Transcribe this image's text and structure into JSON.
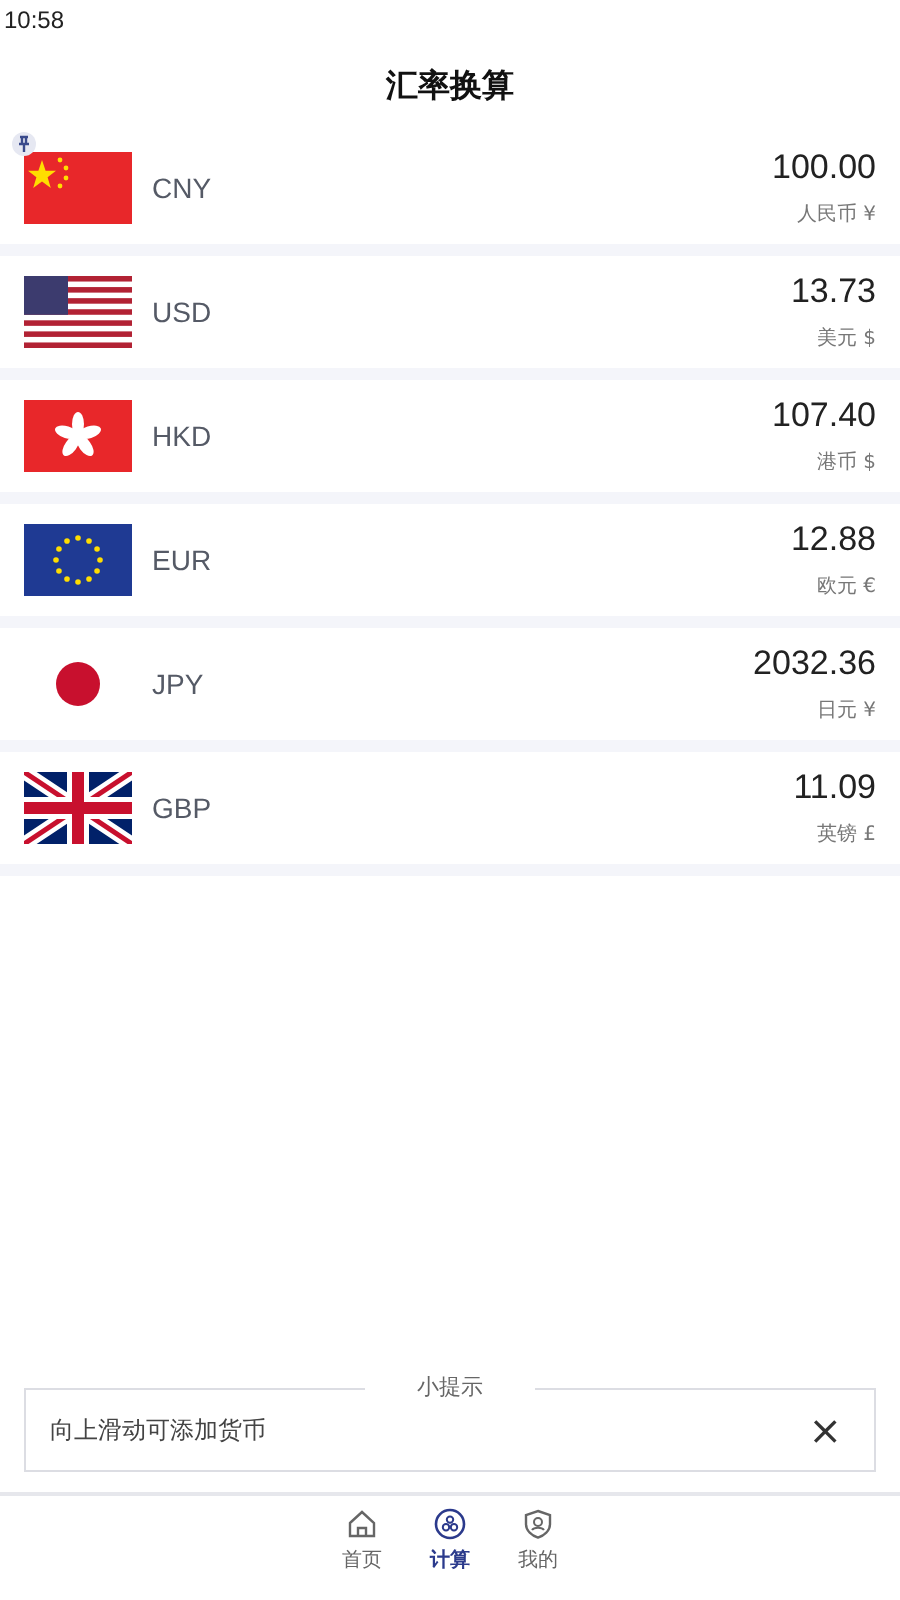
{
  "status_bar": {
    "time": "10:58"
  },
  "title": "汇率换算",
  "currencies": [
    {
      "kind": "cn",
      "code": "CNY",
      "amount": "100.00",
      "name": "人民币 ¥",
      "pinned": true
    },
    {
      "kind": "us",
      "code": "USD",
      "amount": "13.73",
      "name": "美元 $",
      "pinned": false
    },
    {
      "kind": "hk",
      "code": "HKD",
      "amount": "107.40",
      "name": "港币 $",
      "pinned": false
    },
    {
      "kind": "eu",
      "code": "EUR",
      "amount": "12.88",
      "name": "欧元 €",
      "pinned": false
    },
    {
      "kind": "jp",
      "code": "JPY",
      "amount": "2032.36",
      "name": "日元 ¥",
      "pinned": false
    },
    {
      "kind": "gb",
      "code": "GBP",
      "amount": "11.09",
      "name": "英镑 £",
      "pinned": false
    }
  ],
  "tip": {
    "legend": "小提示",
    "text": "向上滑动可添加货币",
    "close": "×"
  },
  "tabs": [
    {
      "kind": "home",
      "label": "首页",
      "selected": false
    },
    {
      "kind": "calc",
      "label": "计算",
      "selected": true
    },
    {
      "kind": "shield",
      "label": "我的",
      "selected": false
    }
  ]
}
